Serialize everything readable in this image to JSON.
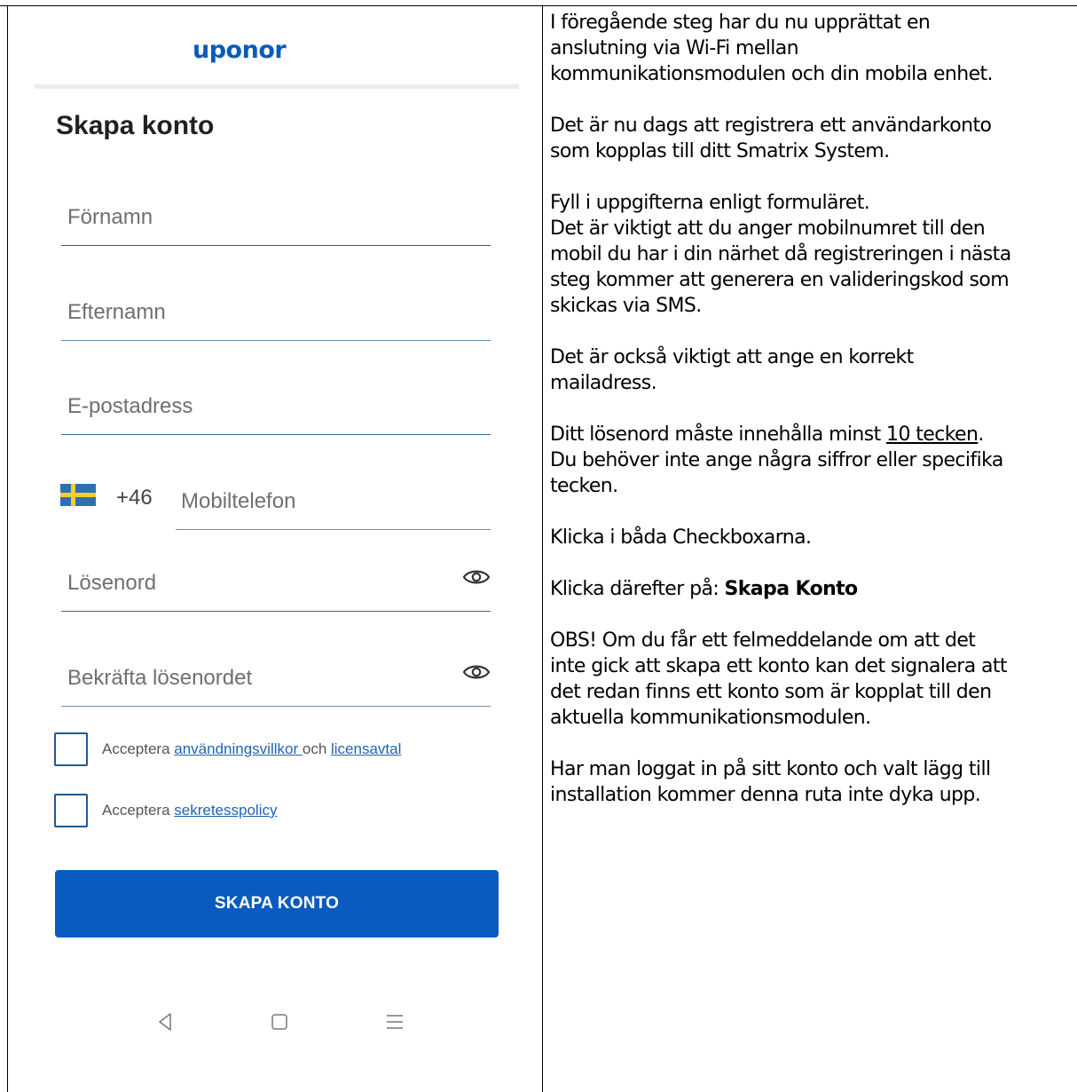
{
  "app": {
    "logo": "uponor",
    "title": "Skapa konto"
  },
  "form": {
    "first_name_placeholder": "Förnamn",
    "last_name_placeholder": "Efternamn",
    "email_placeholder": "E-postadress",
    "country_code": "+46",
    "phone_placeholder": "Mobiltelefon",
    "password_placeholder": "Lösenord",
    "confirm_password_placeholder": "Bekräfta lösenordet"
  },
  "checkboxes": [
    {
      "checked": false,
      "prefix": "Acceptera ",
      "link1": "användningsvillkor ",
      "middle": "och ",
      "link2": "licensavtal"
    },
    {
      "checked": false,
      "prefix": "Acceptera ",
      "link1": "sekretesspolicy"
    }
  ],
  "create_button_label": "SKAPA KONTO",
  "nav_icons": [
    "back-icon",
    "home-icon",
    "menu-icon"
  ],
  "colors": {
    "brand": "#0a5bb6",
    "button": "#0a5bc0",
    "link": "#1f63b5"
  },
  "instructions": {
    "p1": [
      "I föregående steg har du nu upprättat en",
      "anslutning via Wi-Fi mellan",
      "kommunikationsmodulen och din mobila enhet."
    ],
    "p2": [
      "Det är nu dags att registrera ett användarkonto",
      "som kopplas till ditt Smatrix System."
    ],
    "p3": [
      "Fyll i uppgifterna enligt formuläret.",
      "Det är viktigt att du anger mobilnumret till den",
      "mobil du har i din närhet då registreringen i nästa",
      "steg kommer att generera en valideringskod som",
      "skickas via SMS."
    ],
    "p4": [
      "Det är också viktigt att ange en korrekt",
      "mailadress."
    ],
    "p5_prefix": "Ditt lösenord måste innehålla minst ",
    "p5_underlined": "10 tecken",
    "p5_suffix": ".",
    "p5_rest": [
      "Du behöver inte ange några siffror eller specifika",
      "tecken."
    ],
    "p6": "Klicka i båda Checkboxarna.",
    "p7_prefix": "Klicka därefter på: ",
    "p7_bold": "Skapa Konto",
    "p8": [
      "OBS! Om du får ett felmeddelande om att det",
      "inte gick att skapa ett konto kan det signalera att",
      "det redan finns ett konto som är kopplat till den",
      "aktuella kommunikationsmodulen."
    ],
    "p9": [
      "Har man loggat in på sitt konto och valt lägg till",
      "installation kommer denna ruta inte dyka upp."
    ]
  }
}
